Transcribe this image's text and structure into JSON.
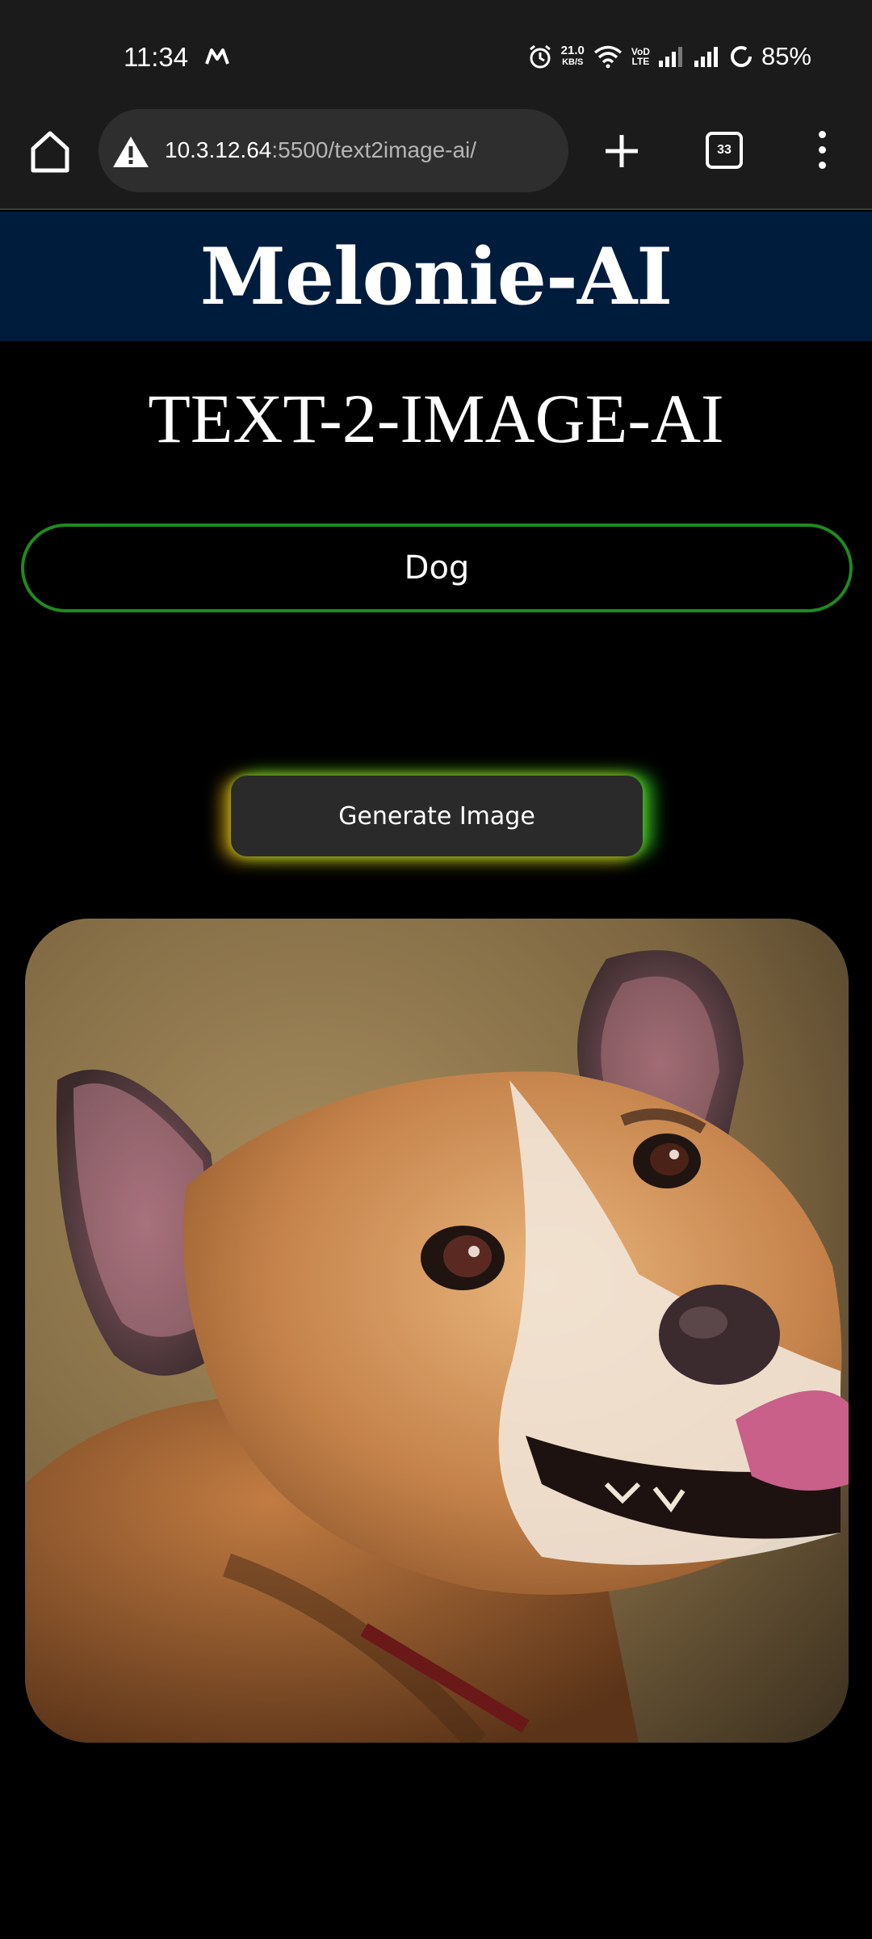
{
  "status_bar": {
    "time": "11:34",
    "speed_value": "21.0",
    "speed_unit": "KB/S",
    "volte_line1": "VoD",
    "volte_line2": "LTE",
    "battery": "85%"
  },
  "browser": {
    "url_host": "10.3.12.64",
    "url_rest": ":5500/text2image-ai/",
    "tab_count": "33"
  },
  "site": {
    "title": "Melonie-AI",
    "heading": "TEXT-2-IMAGE-AI"
  },
  "prompt": {
    "value": "Dog"
  },
  "generate_button": {
    "label": "Generate Image"
  },
  "colors": {
    "header_bg": "#001c3c",
    "input_border": "#1f8a1f",
    "button_glow_left": "#d6aa14",
    "button_glow_right": "#32c828"
  },
  "icons": {
    "home": "home-icon",
    "warning": "warning-icon",
    "new_tab": "plus-icon",
    "tabs": "tabs-icon",
    "menu": "more-vert-icon"
  }
}
